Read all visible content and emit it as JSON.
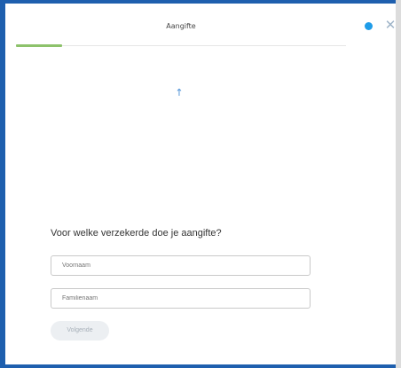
{
  "header": {
    "title": "Aangifte"
  },
  "icons": {
    "help": "help-icon",
    "close": "close-icon",
    "upload": "arrow-up-icon"
  },
  "progress": {
    "fraction": 0.14,
    "color": "#8dc26b"
  },
  "form": {
    "question": "Voor welke verzekerde doe je aangifte?",
    "first_name_placeholder": "Voornaam",
    "last_name_placeholder": "Familienaam",
    "next_label": "Volgende"
  },
  "colors": {
    "frame_border": "#1e5fae",
    "help_dot": "#1f9ce8"
  }
}
